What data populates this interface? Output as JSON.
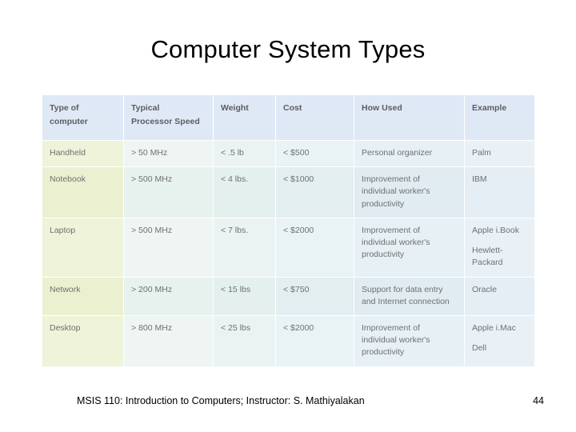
{
  "slide": {
    "title": "Computer System Types",
    "footer_text": "MSIS 110:  Introduction to Computers;  Instructor: S. Mathiyalakan",
    "page_number": "44"
  },
  "table": {
    "headers": [
      "Type of\ncomputer",
      "Typical\nProcessor Speed",
      "Weight",
      "Cost",
      "How Used",
      "Example"
    ],
    "header_lines": [
      [
        "Type of",
        "computer"
      ],
      [
        "Typical",
        "Processor Speed"
      ],
      [
        "Weight"
      ],
      [
        "Cost"
      ],
      [
        "How Used"
      ],
      [
        "Example"
      ]
    ],
    "rows": [
      {
        "type": "Handheld",
        "speed": "> 50 MHz",
        "weight": "< .5 lb",
        "cost": "< $500",
        "how_used": "Personal organizer",
        "example": "Palm"
      },
      {
        "type": "Notebook",
        "speed": "> 500 MHz",
        "weight": "< 4 lbs.",
        "cost": "< $1000",
        "how_used": "Improvement of individual worker's productivity",
        "example": "IBM"
      },
      {
        "type": "Laptop",
        "speed": "> 500 MHz",
        "weight": "< 7 lbs.",
        "cost": "< $2000",
        "how_used": "Improvement of individual worker's productivity",
        "example_line1": "Apple i.Book",
        "example_line2": "Hewlett-Packard"
      },
      {
        "type": "Network",
        "speed": "> 200 MHz",
        "weight": "< 15 lbs",
        "cost": "< $750",
        "how_used": "Support for data entry and Internet connection",
        "example": "Oracle"
      },
      {
        "type": "Desktop",
        "speed": "> 800 MHz",
        "weight": "< 25 lbs",
        "cost": "< $2000",
        "how_used": "Improvement of individual worker's productivity",
        "example_line1": "Apple i.Mac",
        "example_line2": "Dell"
      }
    ]
  }
}
